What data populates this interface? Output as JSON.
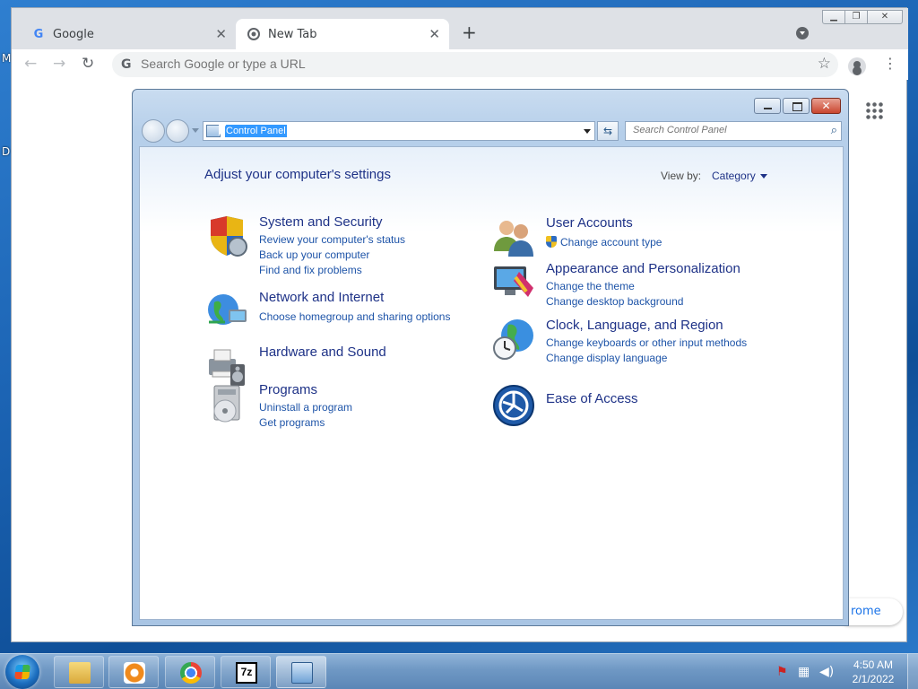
{
  "desktop": {
    "edge_letters": [
      "M",
      "D"
    ]
  },
  "chrome": {
    "tabs": [
      {
        "label": "Google",
        "icon": "google-g-icon"
      },
      {
        "label": "New Tab",
        "icon": "chrome-icon"
      }
    ],
    "omnibox_placeholder": "Search Google or type a URL",
    "partial_pill_text": "rome"
  },
  "control_panel": {
    "address": "Control Panel",
    "search_placeholder": "Search Control Panel",
    "heading": "Adjust your computer's settings",
    "view_by_label": "View by:",
    "view_by_value": "Category",
    "categories": [
      {
        "title": "System and Security",
        "icon": "shield-icon",
        "links": [
          "Review your computer's status",
          "Back up your computer",
          "Find and fix problems"
        ]
      },
      {
        "title": "Network and Internet",
        "icon": "globe-network-icon",
        "links": [
          "Choose homegroup and sharing options"
        ]
      },
      {
        "title": "Hardware and Sound",
        "icon": "printer-speaker-icon",
        "links": []
      },
      {
        "title": "Programs",
        "icon": "programs-disc-icon",
        "links": [
          "Uninstall a program",
          "Get programs"
        ]
      },
      {
        "title": "User Accounts",
        "icon": "users-icon",
        "links": [
          "Change account type"
        ]
      },
      {
        "title": "Appearance and Personalization",
        "icon": "monitor-paint-icon",
        "links": [
          "Change the theme",
          "Change desktop background"
        ]
      },
      {
        "title": "Clock, Language, and Region",
        "icon": "clock-globe-icon",
        "links": [
          "Change keyboards or other input methods",
          "Change display language"
        ]
      },
      {
        "title": "Ease of Access",
        "icon": "ease-of-access-icon",
        "links": []
      }
    ]
  },
  "taskbar": {
    "seven_zip_label": "7z",
    "clock_time": "4:50 AM",
    "clock_date": "2/1/2022"
  },
  "colors": {
    "link_blue": "#1e54a8",
    "title_blue": "#1e3287",
    "selection": "#3399ff"
  }
}
